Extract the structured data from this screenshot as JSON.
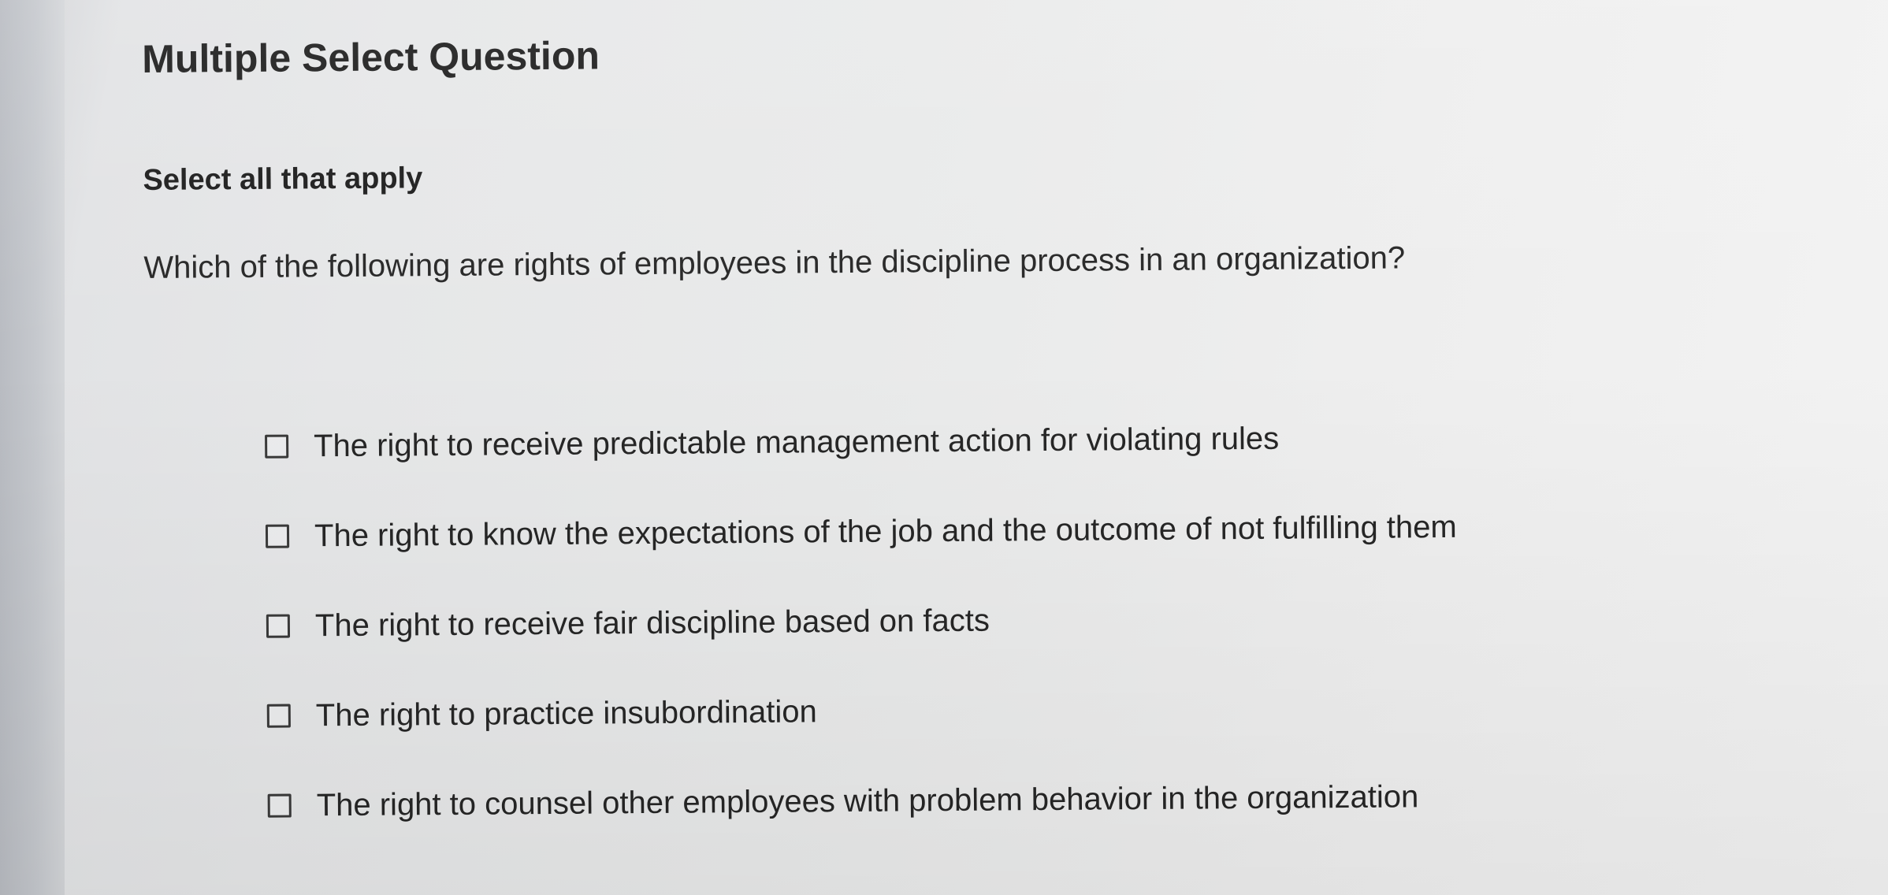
{
  "question": {
    "type_title": "Multiple Select Question",
    "instruction": "Select all that apply",
    "prompt": "Which of the following are rights of employees in the discipline process in an organization?"
  },
  "options": [
    {
      "label": "The right to receive predictable management action for violating rules",
      "checked": false
    },
    {
      "label": "The right to know the expectations of the job and the outcome of not fulfilling them",
      "checked": false
    },
    {
      "label": "The right to receive fair discipline based on facts",
      "checked": false
    },
    {
      "label": "The right to practice insubordination",
      "checked": false
    },
    {
      "label": "The right to counsel other employees with problem behavior in the organization",
      "checked": false
    }
  ]
}
